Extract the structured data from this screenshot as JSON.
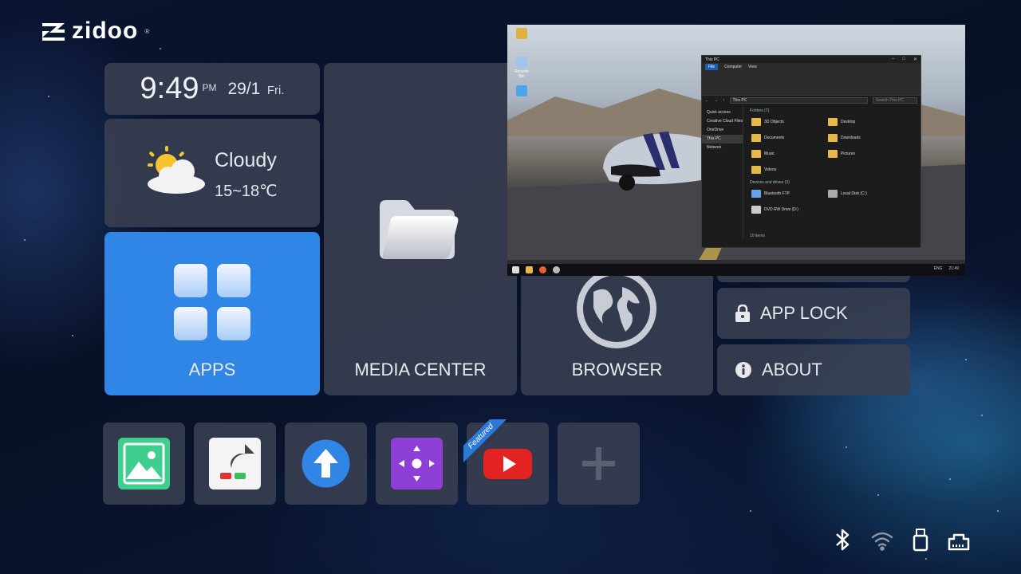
{
  "brand": {
    "name": "zidoo",
    "registered": "®"
  },
  "clock": {
    "time": "9:49",
    "ampm": "PM",
    "date": "29/1",
    "weekday": "Fri."
  },
  "weather": {
    "condition": "Cloudy",
    "temperature": "15~18℃",
    "icon": "partly-cloudy-icon"
  },
  "tiles": {
    "apps": "APPS",
    "media_center": "MEDIA CENTER",
    "browser": "BROWSER",
    "app_lock": "APP LOCK",
    "about": "ABOUT"
  },
  "shortcuts": [
    {
      "icon": "gallery-icon",
      "color": "#3ecf8e"
    },
    {
      "icon": "shortcut-app-icon",
      "color": "#f4f4f4"
    },
    {
      "icon": "upload-arrow-icon",
      "color": "#2f86e6"
    },
    {
      "icon": "remote-dpad-icon",
      "color": "#8e3fd6"
    },
    {
      "icon": "youtube-icon",
      "color": "#e32222",
      "badge": "Featured"
    },
    {
      "icon": "add-icon",
      "color": "#5a6070"
    }
  ],
  "status_icons": [
    "bluetooth-icon",
    "wifi-icon",
    "usb-icon",
    "ethernet-icon"
  ],
  "pip": {
    "desktop_icons": [
      "Recycle Bin"
    ],
    "explorer": {
      "title": "This PC",
      "tabs": [
        "File",
        "Computer",
        "View"
      ],
      "address": "This PC",
      "search_placeholder": "Search This PC",
      "nav": [
        "Quick access",
        "Creative Cloud Files",
        "OneDrive",
        "This PC",
        "Network"
      ],
      "folders_header": "Folders (7)",
      "folders": [
        "3D Objects",
        "Desktop",
        "Documents",
        "Downloads",
        "Music",
        "Pictures",
        "Videos"
      ],
      "devices_header": "Devices and drives (3)",
      "devices": [
        "Bluetooth FTP",
        "Local Disk (C:)",
        "DVD RW Drive (D:)"
      ],
      "items_count": "10 items"
    },
    "taskbar_time": "21:49",
    "taskbar_lang": "ENG"
  }
}
